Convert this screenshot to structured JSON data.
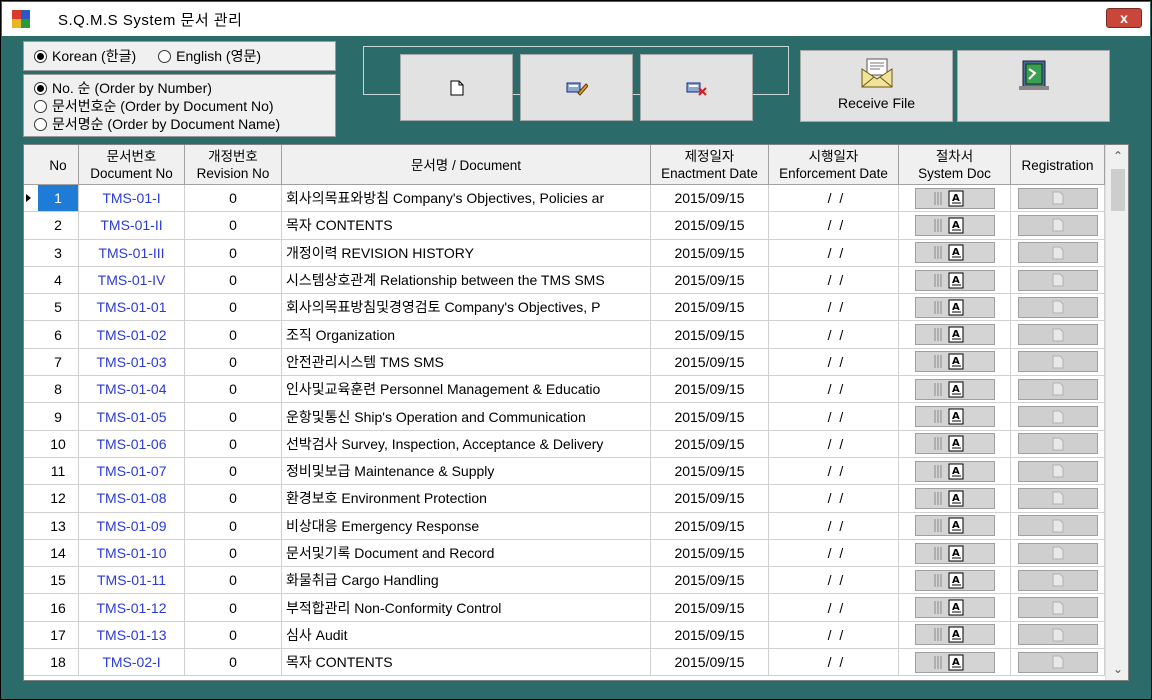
{
  "window": {
    "title": "S.Q.M.S   System  문서 관리",
    "close_label": "x"
  },
  "language": {
    "korean": "Korean (한글)",
    "english": "English (영문)",
    "selected": "korean"
  },
  "sort": {
    "by_number": "No. 순 (Order by Number)",
    "by_doc_no": "문서번호순 (Order by Document No)",
    "by_doc_name": "문서명순 (Order by Document Name)",
    "selected": "by_number"
  },
  "toolbar": {
    "receive_label": "Receive File"
  },
  "columns": {
    "no": "No",
    "docno_ko": "문서번호",
    "docno_en": "Document No",
    "rev_ko": "개정번호",
    "rev_en": "Revision No",
    "docname": "문서명  / Document",
    "enact_ko": "제정일자",
    "enact_en": "Enactment Date",
    "enforce_ko": "시행일자",
    "enforce_en": "Enforcement Date",
    "sysdoc_ko": "절차서",
    "sysdoc_en": "System Doc",
    "registration": "Registration"
  },
  "rows": [
    {
      "no": "1",
      "docno": "TMS-01-I",
      "rev": "0",
      "name": "회사의목표와방침 Company's Objectives, Policies ar",
      "enact": "2015/09/15",
      "enforce": " /  /"
    },
    {
      "no": "2",
      "docno": "TMS-01-II",
      "rev": "0",
      "name": "목자 CONTENTS",
      "enact": "2015/09/15",
      "enforce": " /  /"
    },
    {
      "no": "3",
      "docno": "TMS-01-III",
      "rev": "0",
      "name": "개정이력 REVISION HISTORY",
      "enact": "2015/09/15",
      "enforce": " /  /"
    },
    {
      "no": "4",
      "docno": "TMS-01-IV",
      "rev": "0",
      "name": "시스템상호관계 Relationship between the TMS SMS",
      "enact": "2015/09/15",
      "enforce": " /  /"
    },
    {
      "no": "5",
      "docno": "TMS-01-01",
      "rev": "0",
      "name": "회사의목표방침및경영검토 Company's Objectives, P",
      "enact": "2015/09/15",
      "enforce": " /  /"
    },
    {
      "no": "6",
      "docno": "TMS-01-02",
      "rev": "0",
      "name": "조직 Organization",
      "enact": "2015/09/15",
      "enforce": " /  /"
    },
    {
      "no": "7",
      "docno": "TMS-01-03",
      "rev": "0",
      "name": "안전관리시스템 TMS SMS",
      "enact": "2015/09/15",
      "enforce": " /  /"
    },
    {
      "no": "8",
      "docno": "TMS-01-04",
      "rev": "0",
      "name": "인사및교육훈련 Personnel Management & Educatio",
      "enact": "2015/09/15",
      "enforce": " /  /"
    },
    {
      "no": "9",
      "docno": "TMS-01-05",
      "rev": "0",
      "name": "운항및통신 Ship's Operation and Communication",
      "enact": "2015/09/15",
      "enforce": " /  /"
    },
    {
      "no": "10",
      "docno": "TMS-01-06",
      "rev": "0",
      "name": "선박검사 Survey, Inspection, Acceptance & Delivery",
      "enact": "2015/09/15",
      "enforce": " /  /"
    },
    {
      "no": "11",
      "docno": "TMS-01-07",
      "rev": "0",
      "name": "정비및보급 Maintenance & Supply",
      "enact": "2015/09/15",
      "enforce": " /  /"
    },
    {
      "no": "12",
      "docno": "TMS-01-08",
      "rev": "0",
      "name": "환경보호 Environment Protection",
      "enact": "2015/09/15",
      "enforce": " /  /"
    },
    {
      "no": "13",
      "docno": "TMS-01-09",
      "rev": "0",
      "name": "비상대응 Emergency Response",
      "enact": "2015/09/15",
      "enforce": " /  /"
    },
    {
      "no": "14",
      "docno": "TMS-01-10",
      "rev": "0",
      "name": "문서및기록 Document and Record",
      "enact": "2015/09/15",
      "enforce": " /  /"
    },
    {
      "no": "15",
      "docno": "TMS-01-11",
      "rev": "0",
      "name": "화물취급 Cargo Handling",
      "enact": "2015/09/15",
      "enforce": " /  /"
    },
    {
      "no": "16",
      "docno": "TMS-01-12",
      "rev": "0",
      "name": "부적합관리 Non-Conformity Control",
      "enact": "2015/09/15",
      "enforce": " /  /"
    },
    {
      "no": "17",
      "docno": "TMS-01-13",
      "rev": "0",
      "name": "심사 Audit",
      "enact": "2015/09/15",
      "enforce": " /  /"
    },
    {
      "no": "18",
      "docno": "TMS-02-I",
      "rev": "0",
      "name": "목자 CONTENTS",
      "enact": "2015/09/15",
      "enforce": " /  /"
    }
  ],
  "selected_row": 0,
  "colors": {
    "frame": "#2b6b6a",
    "selection": "#1e7bd6",
    "doc_no_text": "#2a3ad8"
  }
}
